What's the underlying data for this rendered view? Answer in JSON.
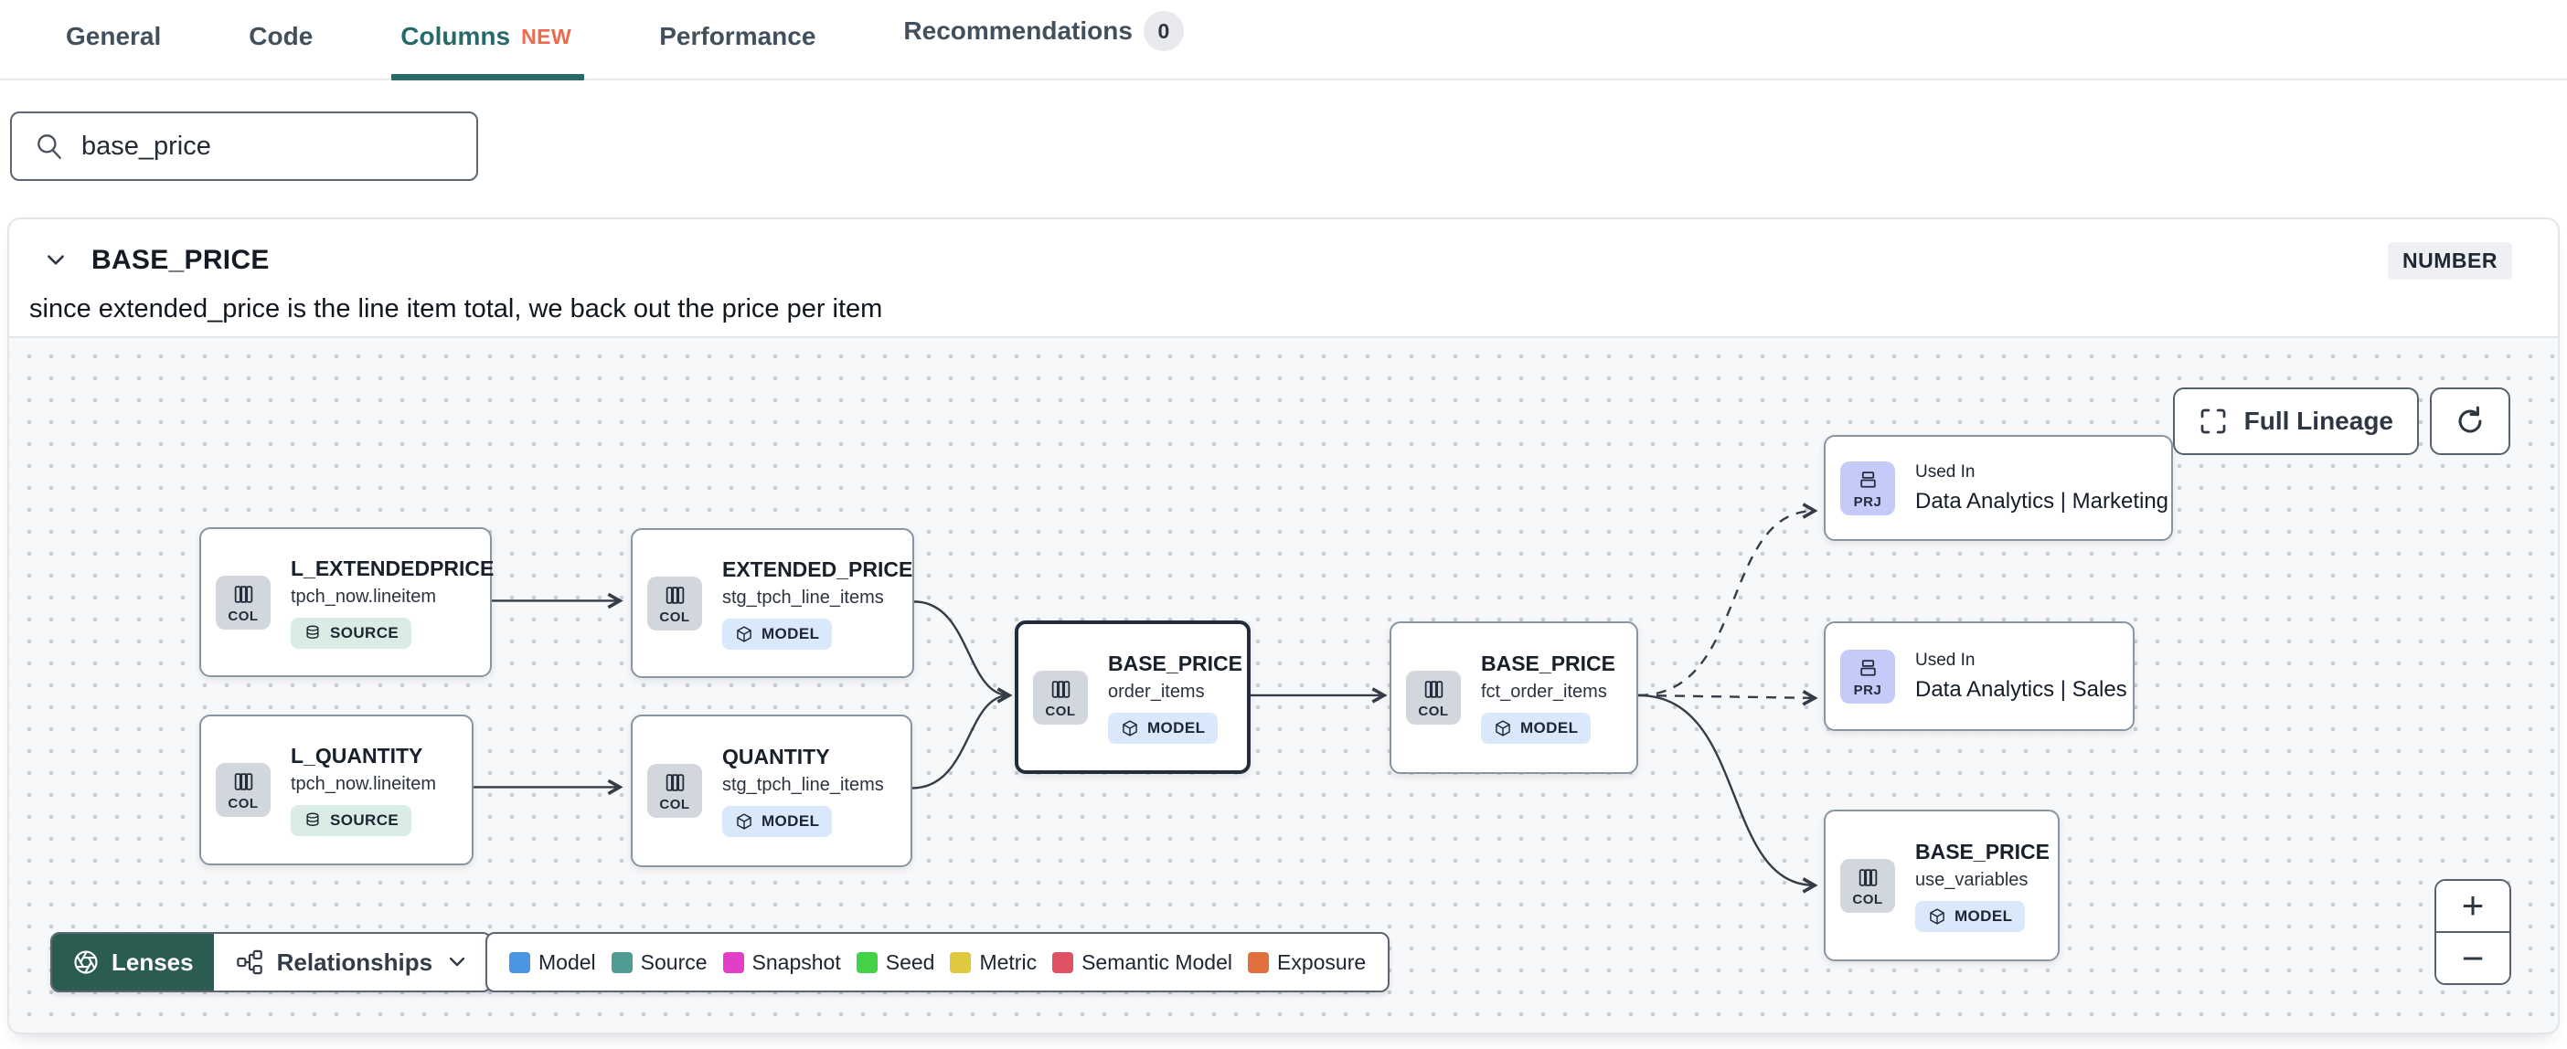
{
  "tabs": [
    {
      "label": "General",
      "active": false
    },
    {
      "label": "Code",
      "active": false
    },
    {
      "label": "Columns",
      "active": true,
      "badge": "NEW"
    },
    {
      "label": "Performance",
      "active": false
    },
    {
      "label": "Recommendations",
      "active": false,
      "count": "0"
    }
  ],
  "search": {
    "value": "base_price"
  },
  "column_panel": {
    "title": "BASE_PRICE",
    "type": "NUMBER",
    "description": "since extended_price is the line item total, we back out the price per item"
  },
  "lineage": {
    "controls": {
      "full_lineage": "Full Lineage",
      "zoom_in": "+",
      "zoom_out": "−"
    },
    "toolbar": {
      "lenses": "Lenses",
      "relationships": "Relationships"
    },
    "nodes": [
      {
        "title": "L_EXTENDEDPRICE",
        "subtitle": "tpch_now.lineitem",
        "badge": "SOURCE",
        "chip": "COL"
      },
      {
        "title": "L_QUANTITY",
        "subtitle": "tpch_now.lineitem",
        "badge": "SOURCE",
        "chip": "COL"
      },
      {
        "title": "EXTENDED_PRICE",
        "subtitle": "stg_tpch_line_items",
        "badge": "MODEL",
        "chip": "COL"
      },
      {
        "title": "QUANTITY",
        "subtitle": "stg_tpch_line_items",
        "badge": "MODEL",
        "chip": "COL"
      },
      {
        "title": "BASE_PRICE",
        "subtitle": "order_items",
        "badge": "MODEL",
        "chip": "COL",
        "selected": true
      },
      {
        "title": "BASE_PRICE",
        "subtitle": "fct_order_items",
        "badge": "MODEL",
        "chip": "COL"
      },
      {
        "label": "Used In",
        "title": "Data Analytics | Marketing",
        "chip": "PRJ"
      },
      {
        "label": "Used In",
        "title": "Data Analytics | Sales",
        "chip": "PRJ"
      },
      {
        "title": "BASE_PRICE",
        "subtitle": "use_variables",
        "badge": "MODEL",
        "chip": "COL"
      }
    ],
    "legend": [
      {
        "label": "Model",
        "color": "#4b96e3"
      },
      {
        "label": "Source",
        "color": "#4e9c94"
      },
      {
        "label": "Snapshot",
        "color": "#e23ec8"
      },
      {
        "label": "Seed",
        "color": "#43d147"
      },
      {
        "label": "Metric",
        "color": "#e0c83f"
      },
      {
        "label": "Semantic Model",
        "color": "#e05263"
      },
      {
        "label": "Exposure",
        "color": "#e0713c"
      }
    ],
    "colors": {
      "accent_teal": "#26696b",
      "new_badge": "#ed6a4f",
      "lenses_green": "#2b5c52",
      "selected_border": "#232c3a",
      "edge": "#343c47"
    }
  }
}
